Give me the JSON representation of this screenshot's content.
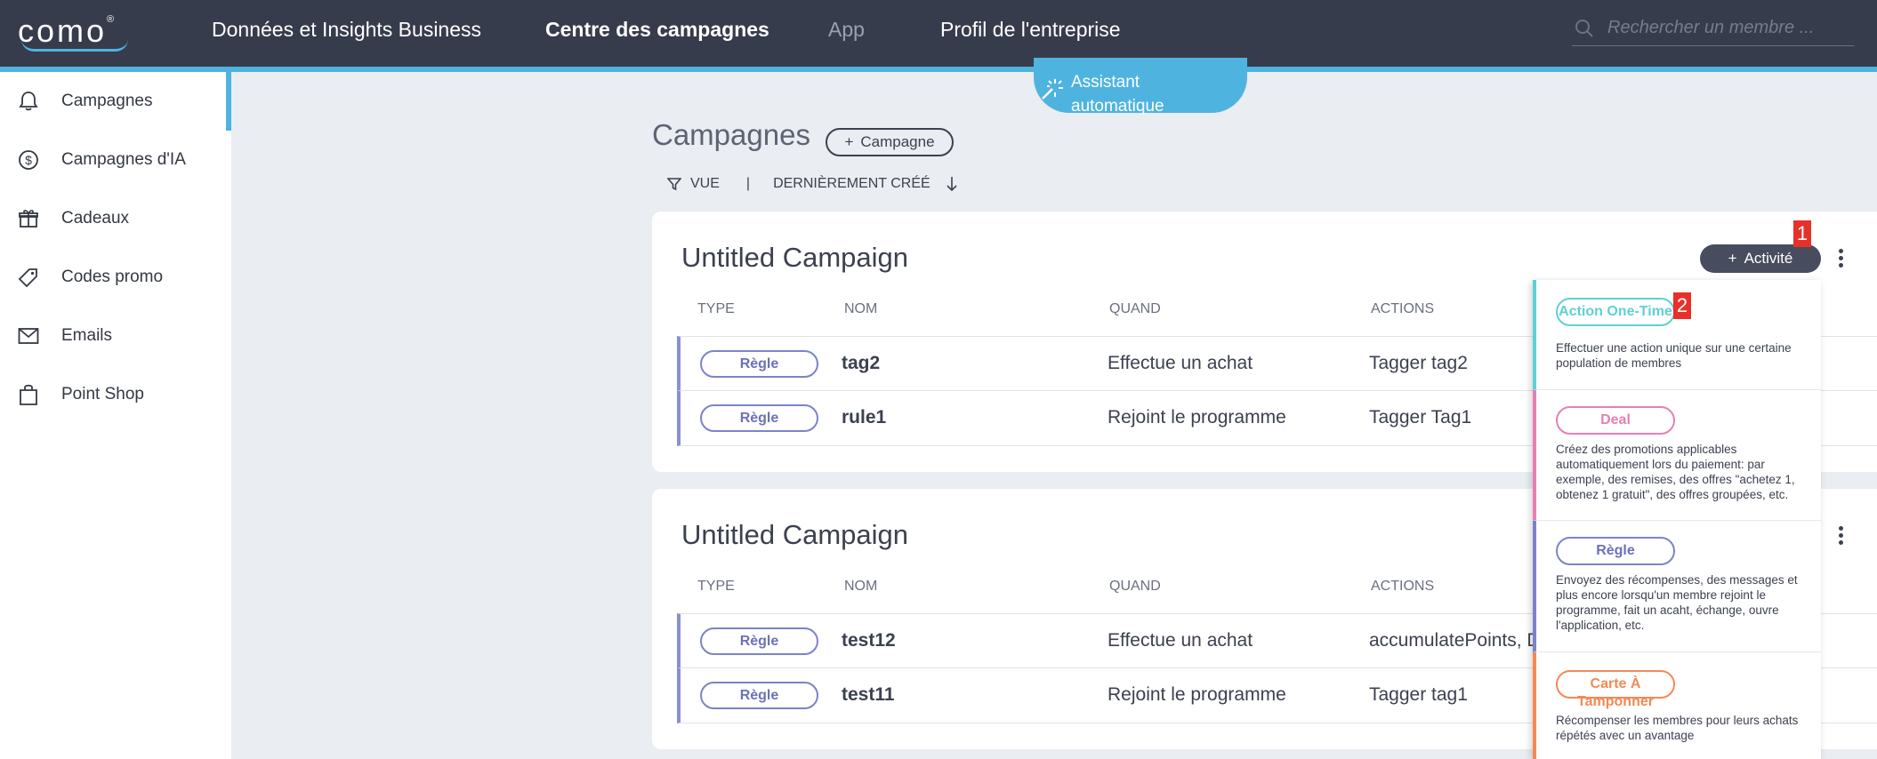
{
  "topbar": {
    "logo": "como",
    "logo_reg": "®",
    "nav": [
      "Données et Insights Business",
      "Centre des campagnes",
      "App",
      "Profil de l'entreprise"
    ],
    "search_placeholder": "Rechercher un membre ..."
  },
  "sidebar": {
    "items": [
      {
        "label": "Campagnes",
        "icon": "bell-icon"
      },
      {
        "label": "Campagnes d'IA",
        "icon": "dollar-circle-icon"
      },
      {
        "label": "Cadeaux",
        "icon": "gift-icon"
      },
      {
        "label": "Codes promo",
        "icon": "tag-icon"
      },
      {
        "label": "Emails",
        "icon": "envelope-icon"
      },
      {
        "label": "Point Shop",
        "icon": "shopping-bag-icon"
      }
    ]
  },
  "assistant": {
    "label": "Assistant automatique"
  },
  "header": {
    "title": "Campagnes",
    "add_label": "Campagne",
    "view_label": "VUE",
    "separator": "|",
    "sort_label": "DERNIÈREMENT CRÉÉ"
  },
  "columns": [
    "TYPE",
    "NOM",
    "QUAND",
    "ACTIONS"
  ],
  "campaigns": [
    {
      "title": "Untitled Campaign",
      "rows": [
        {
          "type": "Règle",
          "name": "tag2",
          "when": "Effectue un achat",
          "actions": "Tagger tag2"
        },
        {
          "type": "Règle",
          "name": "rule1",
          "when": "Rejoint le programme",
          "actions": "Tagger Tag1"
        }
      ]
    },
    {
      "title": "Untitled Campaign",
      "rows": [
        {
          "type": "Règle",
          "name": "test12",
          "when": "Effectue un achat",
          "actions": "accumulatePoints, D"
        },
        {
          "type": "Règle",
          "name": "test11",
          "when": "Rejoint le programme",
          "actions": "Tagger tag1"
        }
      ]
    }
  ],
  "activity_button": {
    "label": "Activité"
  },
  "markers": [
    "1",
    "2"
  ],
  "menu": {
    "items": [
      {
        "label": "Action One-Time",
        "color": "#5fd0d6",
        "desc": "Effectuer une action unique sur une certaine population de membres"
      },
      {
        "label": "Deal",
        "color": "#e77fb4",
        "desc": "Créez des promotions applicables automatiquement lors du paiement: par exemple, des remises, des offres \"achetez 1, obtenez 1 gratuit\", des offres groupées, etc."
      },
      {
        "label": "Règle",
        "color": "#7c83c8",
        "desc": "Envoyez des récompenses, des messages et plus encore lorsqu'un membre rejoint le programme, fait un acaht, échange, ouvre l'application, etc."
      },
      {
        "label": "Carte À Tamponner",
        "color": "#f28a55",
        "desc": "Récompenser les membres pour leurs achats répétés avec un avantage"
      }
    ]
  },
  "colors": {
    "topbar": "#373c4c",
    "accent": "#4fb3e0",
    "rule_purple": "#7c83c8",
    "marker_red": "#e8302a"
  }
}
